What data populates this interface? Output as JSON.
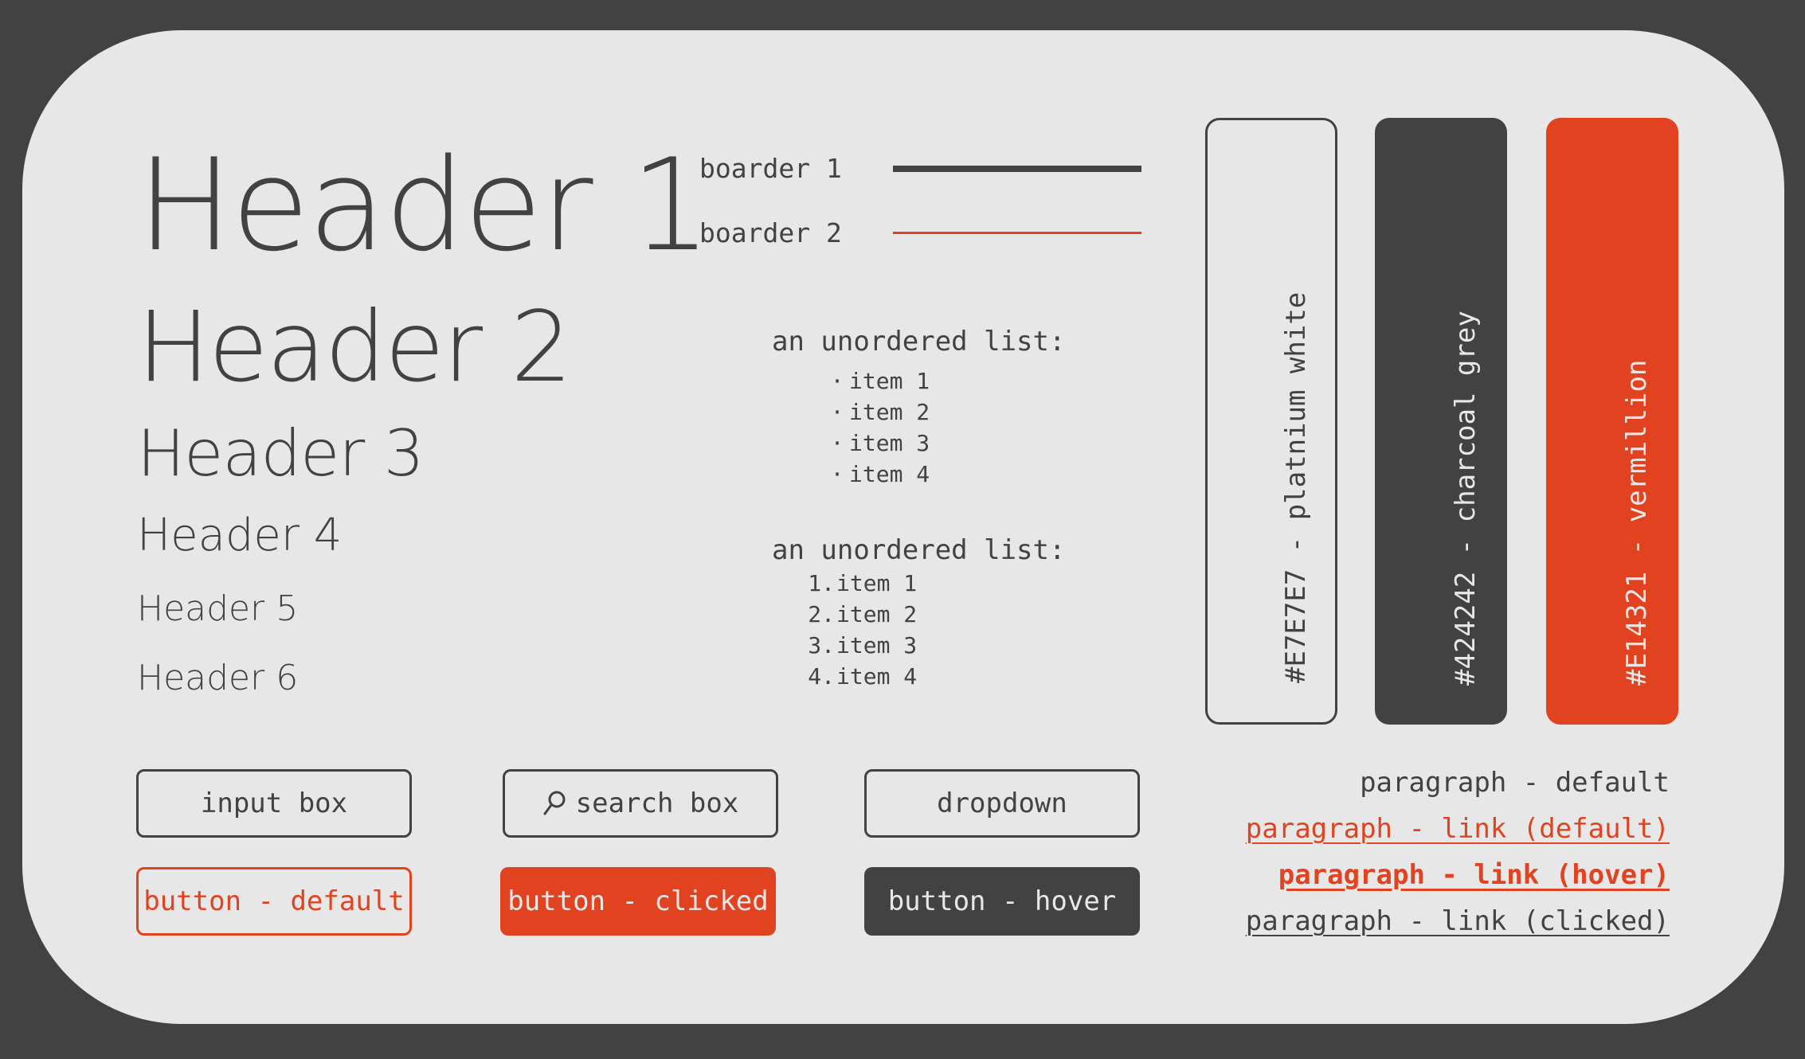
{
  "headers": {
    "h1": "Header 1",
    "h2": "Header 2",
    "h3": "Header 3",
    "h4": "Header 4",
    "h5": "Header 5",
    "h6": "Header 6"
  },
  "borders": {
    "border1_label": "boarder 1",
    "border2_label": "boarder 2"
  },
  "unordered_list": {
    "title": "an unordered list:",
    "items": [
      "item 1",
      "item 2",
      "item 3",
      "item 4"
    ]
  },
  "ordered_list": {
    "title": "an unordered list:",
    "numbers": [
      "1.",
      "2.",
      "3.",
      "4."
    ],
    "items": [
      "item 1",
      "item 2",
      "item 3",
      "item 4"
    ]
  },
  "swatches": [
    {
      "label": "#E7E7E7 - platnium white",
      "color": "#E7E7E7"
    },
    {
      "label": "#424242 - charcoal grey",
      "color": "#424242"
    },
    {
      "label": "#E14321 - vermillion",
      "color": "#E14321"
    }
  ],
  "inputs": {
    "input_box": "input box",
    "search_box": "search box",
    "dropdown": "dropdown"
  },
  "buttons": {
    "default": "button - default",
    "clicked": "button - clicked",
    "hover": "button - hover"
  },
  "paragraphs": {
    "default": "paragraph - default",
    "link_default": "paragraph - link (default)",
    "link_hover": "paragraph - link (hover)",
    "link_clicked": "paragraph - link (clicked)"
  },
  "icons": {
    "search": "search-icon"
  },
  "colors": {
    "background": "#424242",
    "card": "#E7E7E7",
    "accent": "#E14321",
    "text": "#424242"
  }
}
